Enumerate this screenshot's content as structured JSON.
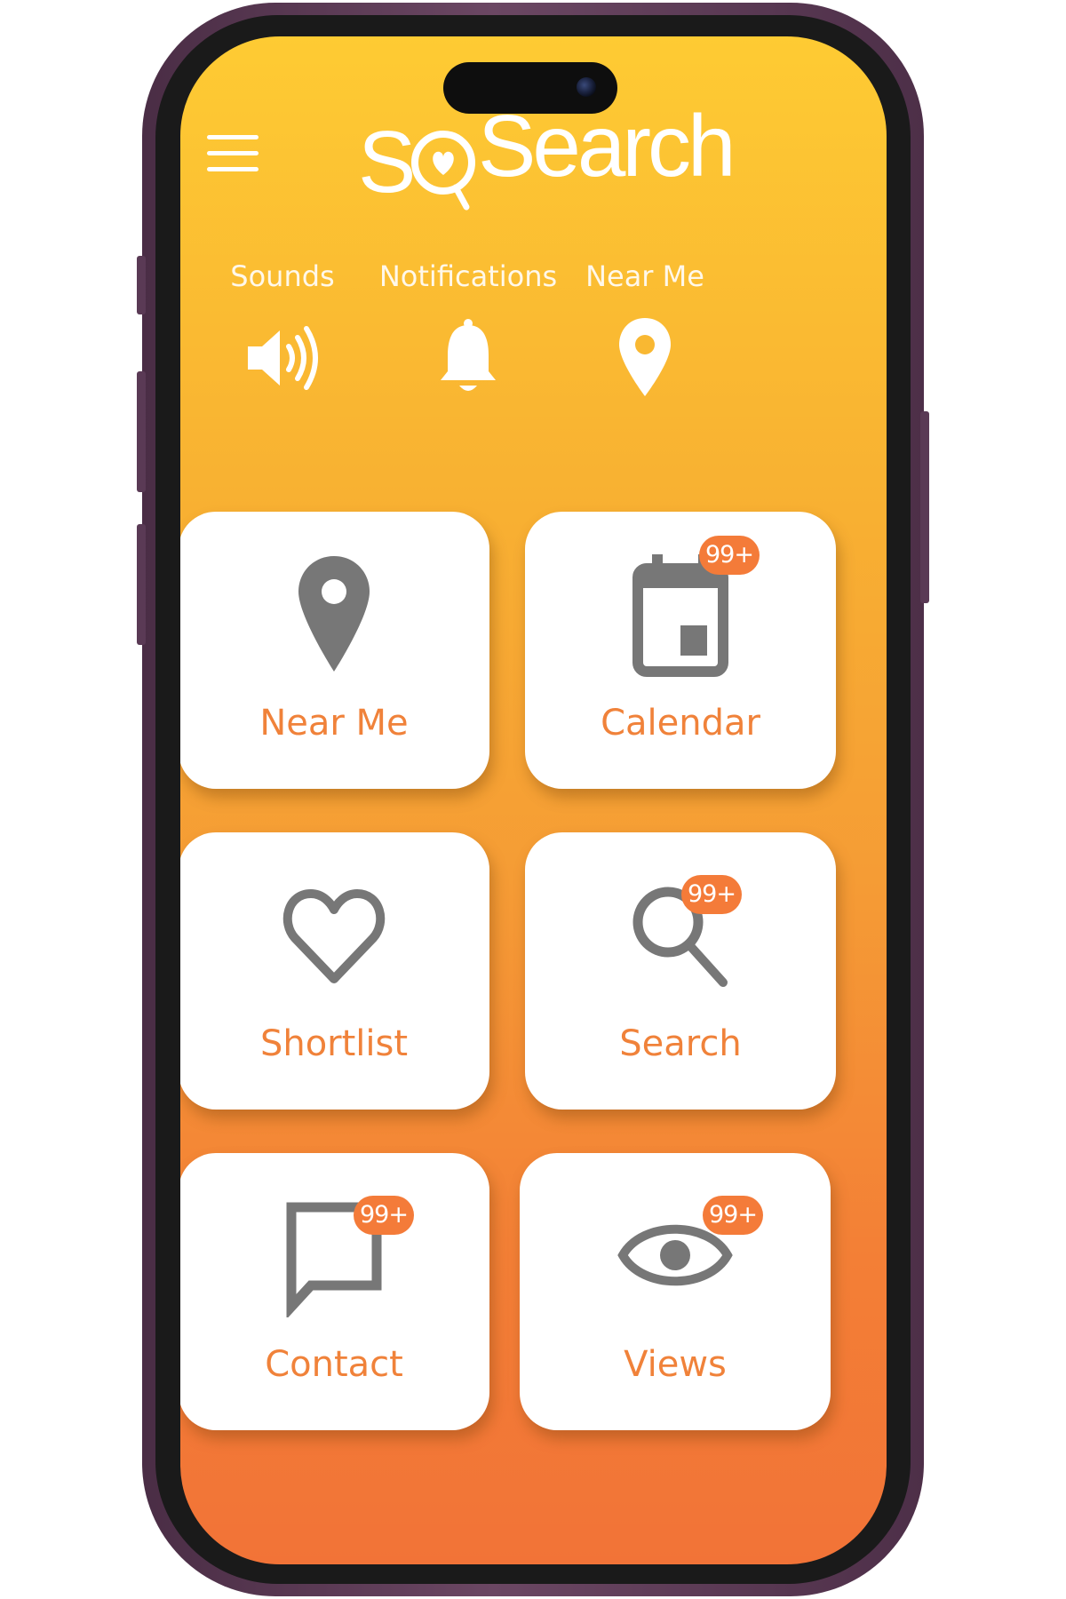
{
  "app": {
    "logo_text": "SQSearch"
  },
  "header": {
    "menu_icon": "hamburger-menu-icon"
  },
  "quick_actions": [
    {
      "label": "Sounds",
      "icon": "speaker-icon"
    },
    {
      "label": "Notifications",
      "icon": "bell-icon"
    },
    {
      "label": "Near Me",
      "icon": "location-pin-icon"
    }
  ],
  "tiles": [
    {
      "label": "Near Me",
      "icon": "location-pin-icon",
      "badge": ""
    },
    {
      "label": "Calendar",
      "icon": "calendar-icon",
      "badge": "99+"
    },
    {
      "label": "Shortlist",
      "icon": "heart-icon",
      "badge": ""
    },
    {
      "label": "Search",
      "icon": "search-icon",
      "badge": "99+"
    },
    {
      "label": "Contact",
      "icon": "chat-bubble-icon",
      "badge": "99+"
    },
    {
      "label": "Views",
      "icon": "eye-icon",
      "badge": "99+"
    }
  ],
  "colors": {
    "gradient_top": "#fecb33",
    "gradient_bottom": "#f27337",
    "accent": "#f0823a",
    "badge": "#f47b39",
    "icon_gray": "#777777",
    "frame": "#5a3a55"
  }
}
